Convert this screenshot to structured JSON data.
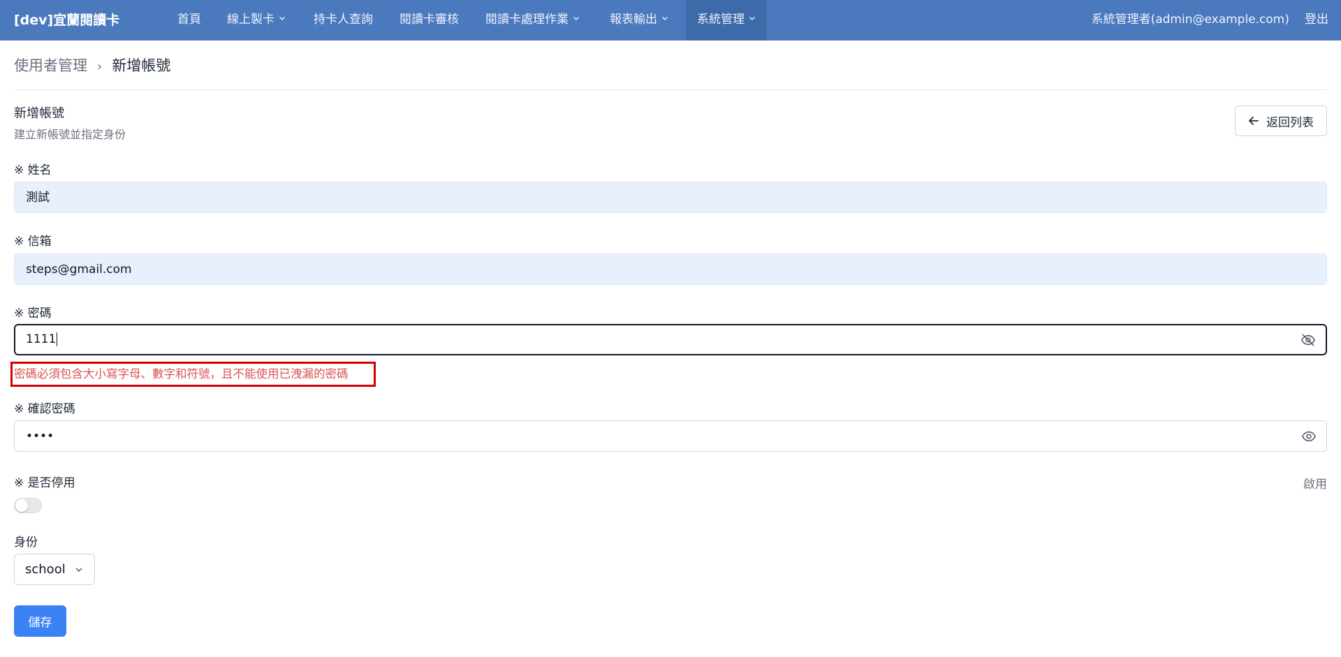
{
  "app": {
    "brand": "[dev]宜蘭閱讀卡"
  },
  "nav": {
    "items": [
      {
        "label": "首頁",
        "has_dropdown": false
      },
      {
        "label": "線上製卡",
        "has_dropdown": true
      },
      {
        "label": "持卡人查詢",
        "has_dropdown": false
      },
      {
        "label": "閱讀卡審核",
        "has_dropdown": false
      },
      {
        "label": "閱讀卡處理作業",
        "has_dropdown": true
      },
      {
        "label": "報表輸出",
        "has_dropdown": true
      },
      {
        "label": "系統管理",
        "has_dropdown": true,
        "active": true
      }
    ],
    "user": "系統管理者(admin@example.com)",
    "logout": "登出"
  },
  "breadcrumb": {
    "parent": "使用者管理",
    "separator": "›",
    "current": "新增帳號"
  },
  "section": {
    "title": "新增帳號",
    "subtitle": "建立新帳號並指定身份",
    "back_label": "返回列表"
  },
  "form": {
    "name": {
      "label": "※ 姓名",
      "value": "測試"
    },
    "email": {
      "label": "※ 信箱",
      "value": "steps@gmail.com"
    },
    "password": {
      "label": "※ 密碼",
      "value": "1111",
      "error": "密碼必須包含大小寫字母、數字和符號，且不能使用已洩漏的密碼"
    },
    "confirm_password": {
      "label": "※ 確認密碼",
      "value": "••••"
    },
    "disabled": {
      "label": "※ 是否停用",
      "status": "啟用",
      "checked": false
    },
    "role": {
      "label": "身份",
      "value": "school"
    },
    "save_label": "儲存"
  },
  "colors": {
    "nav_bg": "#4a79be",
    "primary": "#3b82f6",
    "error": "#d9534f",
    "highlight_box": "#d40000",
    "autofill_bg": "#e8f0fe"
  }
}
